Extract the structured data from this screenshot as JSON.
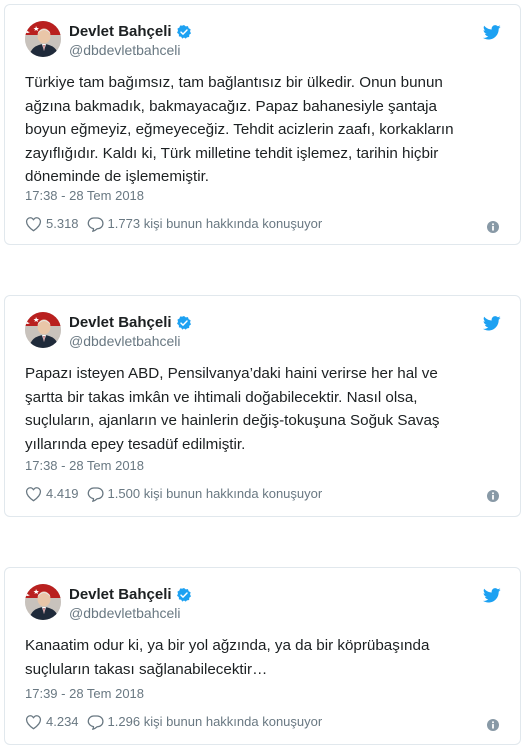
{
  "colors": {
    "twitter_blue": "#1da1f2",
    "verified_blue": "#1da1f2",
    "text": "#1c2022",
    "muted": "#697882",
    "border": "#e1e8ed"
  },
  "icons": {
    "verified": "verified-badge-icon",
    "brand": "twitter-bird-icon",
    "like": "heart-icon",
    "reply": "speech-bubble-icon",
    "info": "info-icon"
  },
  "tweets": [
    {
      "author": {
        "name": "Devlet Bahçeli",
        "handle": "@dbdevletbahceli",
        "verified": true
      },
      "text": "Türkiye tam bağımsız, tam bağlantısız bir ülkedir. Onun bunun\nağzına bakmadık, bakmayacağız. Papaz bahanesiyle şantaja\nboyun eğmeyiz, eğmeyeceğiz. Tehdit acizlerin zaafı, korkakların\nzayıflığıdır. Kaldı ki, Türk milletine tehdit işlemez, tarihin hiçbir\ndöneminde de işlememiştir.",
      "timestamp": "17:38 - 28 Tem 2018",
      "likes": "5.318",
      "conversation": "1.773 kişi bunun hakkında konuşuyor"
    },
    {
      "author": {
        "name": "Devlet Bahçeli",
        "handle": "@dbdevletbahceli",
        "verified": true
      },
      "text": "Papazı isteyen ABD, Pensilvanya’daki haini verirse her hal ve\nşartta bir takas imkân ve ihtimali doğabilecektir. Nasıl olsa,\nsuçluların, ajanların ve hainlerin değiş-tokuşuna Soğuk Savaş\nyıllarında epey tesadüf edilmiştir.",
      "timestamp": "17:38 - 28 Tem 2018",
      "likes": "4.419",
      "conversation": "1.500 kişi bunun hakkında konuşuyor"
    },
    {
      "author": {
        "name": "Devlet Bahçeli",
        "handle": "@dbdevletbahceli",
        "verified": true
      },
      "text": "Kanaatim odur ki, ya bir yol ağzında, ya da bir köprübaşında\nsuçluların takası sağlanabilecektir…",
      "timestamp": "17:39 - 28 Tem 2018",
      "likes": "4.234",
      "conversation": "1.296 kişi bunun hakkında konuşuyor"
    }
  ]
}
